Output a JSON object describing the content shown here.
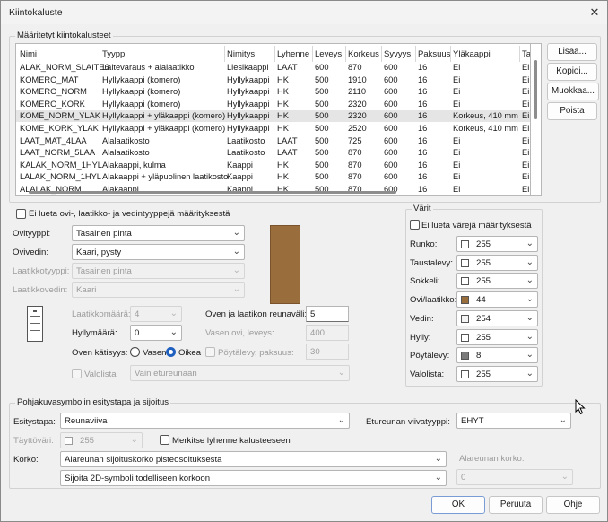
{
  "window": {
    "title": "Kiintokaluste",
    "close_glyph": "✕"
  },
  "defined_group": {
    "label": "Määritetyt kiintokalusteet"
  },
  "table": {
    "columns": [
      "Nimi",
      "Tyyppi",
      "Nimitys",
      "Lyhenne",
      "Leveys",
      "Korkeus",
      "Syvyys",
      "Paksuus",
      "Yläkaappi",
      "Ta"
    ],
    "rows": [
      [
        "ALAK_NORM_SLAITE6",
        "Laitevaraus + alalaatikko",
        "Liesikaappi",
        "LAAT",
        "600",
        "870",
        "600",
        "16",
        "Ei",
        "Ei"
      ],
      [
        "KOMERO_MAT",
        "Hyllykaappi (komero)",
        "Hyllykaappi",
        "HK",
        "500",
        "1910",
        "600",
        "16",
        "Ei",
        "Ei"
      ],
      [
        "KOMERO_NORM",
        "Hyllykaappi (komero)",
        "Hyllykaappi",
        "HK",
        "500",
        "2110",
        "600",
        "16",
        "Ei",
        "Ei"
      ],
      [
        "KOMERO_KORK",
        "Hyllykaappi (komero)",
        "Hyllykaappi",
        "HK",
        "500",
        "2320",
        "600",
        "16",
        "Ei",
        "Ei"
      ],
      [
        "KOME_NORM_YLAK",
        "Hyllykaappi + yläkaappi (komero)",
        "Hyllykaappi",
        "HK",
        "500",
        "2320",
        "600",
        "16",
        "Korkeus, 410 mm",
        "Ei"
      ],
      [
        "KOME_KORK_YLAK",
        "Hyllykaappi + yläkaappi (komero)",
        "Hyllykaappi",
        "HK",
        "500",
        "2520",
        "600",
        "16",
        "Korkeus, 410 mm",
        "Ei"
      ],
      [
        "LAAT_MAT_4LAA",
        "Alalaatikosto",
        "Laatikosto",
        "LAAT",
        "500",
        "725",
        "600",
        "16",
        "Ei",
        "Ei"
      ],
      [
        "LAAT_NORM_5LAA",
        "Alalaatikosto",
        "Laatikosto",
        "LAAT",
        "500",
        "870",
        "600",
        "16",
        "Ei",
        "Ei"
      ],
      [
        "KALAK_NORM_1HYL",
        "Alakaappi, kulma",
        "Kaappi",
        "HK",
        "500",
        "870",
        "600",
        "16",
        "Ei",
        "Ei"
      ],
      [
        "LALAK_NORM_1HYL",
        "Alakaappi + yläpuolinen laatikosto",
        "Kaappi",
        "HK",
        "500",
        "870",
        "600",
        "16",
        "Ei",
        "Ei"
      ],
      [
        "ALALAK_NORM",
        "Alakaappi",
        "Kaappi",
        "HK",
        "500",
        "870",
        "600",
        "16",
        "Ei",
        "Ei"
      ]
    ]
  },
  "side_buttons": {
    "add": "Lisää...",
    "copy": "Kopioi...",
    "edit": "Muokkaa...",
    "delete": "Poista"
  },
  "exclude_types": "Ei lueta ovi-, laatikko- ja vedintyyppejä määrityksestä",
  "fields": {
    "door_type_label": "Ovityyppi:",
    "door_type": "Tasainen pinta",
    "door_handle_label": "Ovivedin:",
    "door_handle": "Kaari, pysty",
    "drawer_type_label": "Laatikkotyyppi:",
    "drawer_type": "Tasainen pinta",
    "drawer_handle_label": "Laatikkovedin:",
    "drawer_handle": "Kaari",
    "drawer_count_label": "Laatikkomäärä:",
    "drawer_count": "4",
    "shelf_count_label": "Hyllymäärä:",
    "shelf_count": "0",
    "edge_gap_label": "Oven ja laatikon reunaväli:",
    "edge_gap": "5",
    "left_door_width_label": "Vasen ovi, leveys:",
    "left_door_width": "400",
    "handedness_label": "Oven kätisyys:",
    "left": "Vasen",
    "right": "Oikea",
    "countertop_label": "Pöytälevy, paksuus:",
    "countertop": "30",
    "valance_label": "Valolista",
    "valance": "Vain etureunaan"
  },
  "colors_group": {
    "label": "Värit",
    "exclude_colors": "Ei lueta värejä määrityksestä",
    "items": [
      {
        "label": "Runko:",
        "value": "255",
        "swatch": "#ffffff"
      },
      {
        "label": "Taustalevy:",
        "value": "255",
        "swatch": "#ffffff"
      },
      {
        "label": "Sokkeli:",
        "value": "255",
        "swatch": "#ffffff"
      },
      {
        "label": "Ovi/laatikko:",
        "value": "44",
        "swatch": "#9a6d3c"
      },
      {
        "label": "Vedin:",
        "value": "254",
        "swatch": "#f4f4f4"
      },
      {
        "label": "Hylly:",
        "value": "255",
        "swatch": "#ffffff"
      },
      {
        "label": "Pöytälevy:",
        "value": "8",
        "swatch": "#7a7a7a"
      },
      {
        "label": "Valolista:",
        "value": "255",
        "swatch": "#ffffff"
      }
    ]
  },
  "plan_group": {
    "label": "Pohjakuvasymbolin esitystapa ja sijoitus",
    "display_label": "Esitystapa:",
    "display": "Reunaviiva",
    "fill_label": "Täyttöväri:",
    "fill": "255",
    "mark_abbrev": "Merkitse lyhenne kalusteeseen",
    "front_line_label": "Etureunan viivatyyppi:",
    "front_line": "EHYT",
    "height_label": "Korko:",
    "height": "Alareunan sijoituskorko pisteosoituksesta",
    "bottom_height_label": "Alareunan korko:",
    "bottom_height": "0",
    "placement": "Sijoita 2D-symboli todelliseen korkoon"
  },
  "footer": {
    "ok": "OK",
    "cancel": "Peruuta",
    "help": "Ohje"
  }
}
